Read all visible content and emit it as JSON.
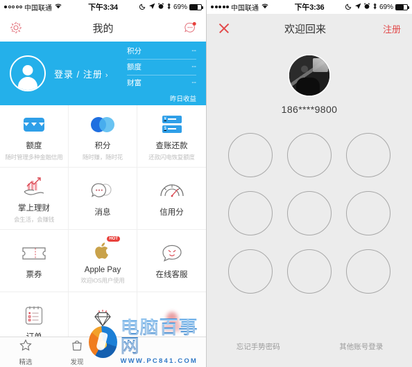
{
  "left": {
    "statusbar": {
      "carrier": "中国联通",
      "time": "下午3:34",
      "battery_pct": "69%",
      "signal_dots_filled": 1
    },
    "nav": {
      "settings_icon": "gear-icon",
      "title": "我的",
      "message_icon": "chat-bubble-icon"
    },
    "banner": {
      "avatar_icon": "person-avatar-icon",
      "login_label": "登录 / 注册",
      "chevron": "›",
      "stats": [
        {
          "label": "积分",
          "value": "--"
        },
        {
          "label": "额度",
          "value": "--"
        },
        {
          "label": "财富",
          "value": "--"
        }
      ],
      "footer": "昨日收益"
    },
    "grid": [
      {
        "icon": "credit-card-icon",
        "label": "额度",
        "sub": "随时管理多种金融信用",
        "badge": ""
      },
      {
        "icon": "two-circles-icon",
        "label": "积分",
        "sub": "随时赚，随时花",
        "badge": ""
      },
      {
        "icon": "bill-repay-icon",
        "label": "查账还款",
        "sub": "还款闪电恢复额度",
        "badge": ""
      },
      {
        "icon": "chart-hand-icon",
        "label": "掌上理财",
        "sub": "会生活，会赚钱",
        "badge": ""
      },
      {
        "icon": "chat-dots-icon",
        "label": "消息",
        "sub": "",
        "badge": ""
      },
      {
        "icon": "credit-gauge-icon",
        "label": "信用分",
        "sub": "",
        "badge": ""
      },
      {
        "icon": "ticket-icon",
        "label": "票券",
        "sub": "",
        "badge": ""
      },
      {
        "icon": "apple-logo-icon",
        "label": "Apple Pay",
        "sub": "欢迎iOS用户使用",
        "badge": "HOT"
      },
      {
        "icon": "service-face-icon",
        "label": "在线客服",
        "sub": "",
        "badge": ""
      },
      {
        "icon": "order-list-icon",
        "label": "订单",
        "sub": "",
        "badge": ""
      },
      {
        "icon": "diamond-icon",
        "label": "",
        "sub": "",
        "badge": ""
      },
      {
        "icon": "blurred-icon",
        "label": "",
        "sub": "",
        "badge": ""
      }
    ],
    "tabbar": [
      {
        "icon": "star-icon",
        "label": "精选"
      },
      {
        "icon": "bag-icon",
        "label": "发现"
      }
    ]
  },
  "right": {
    "statusbar": {
      "carrier": "中国联通",
      "time": "下午3:36",
      "battery_pct": "69%",
      "signal_dots_filled": 5
    },
    "nav": {
      "close_icon": "close-x-icon",
      "title": "欢迎回来",
      "register_label": "注册"
    },
    "account": {
      "avatar_icon": "user-photo-avatar",
      "phone": "186****9800"
    },
    "lock": {
      "nodes": 9,
      "node_icon": "gesture-node-circle"
    },
    "footer": {
      "forgot_label": "忘记手势密码",
      "other_label": "其他账号登录"
    }
  },
  "watermark": {
    "cn": "电脑百事网",
    "url": "WWW.PC841.COM",
    "logo_icon": "site-logo-icon"
  },
  "colors": {
    "brand_blue": "#24b0ea",
    "accent_red": "#e2494a",
    "panel_gray": "#ececec"
  }
}
